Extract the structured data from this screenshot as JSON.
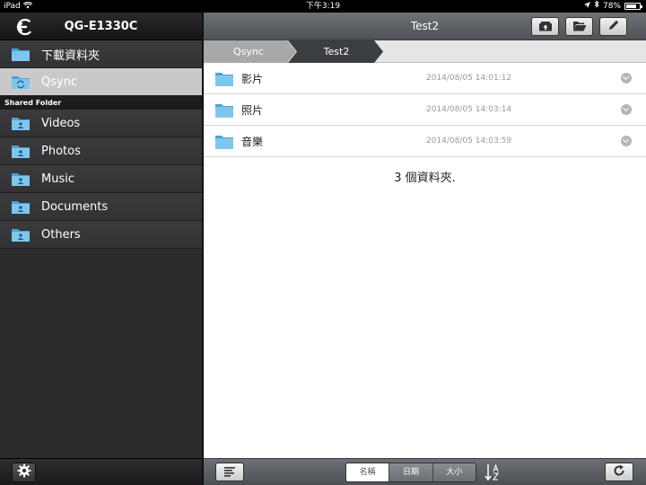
{
  "status_bar": {
    "device": "iPad",
    "time": "下午3:19",
    "battery": "78%",
    "battery_level": 0.78
  },
  "sidebar": {
    "title": "QG-E1330C",
    "items": [
      {
        "label": "下載資料夾",
        "icon": "folder-icon",
        "selected": false
      },
      {
        "label": "Qsync",
        "icon": "qsync-folder-icon",
        "selected": true
      }
    ],
    "section_label": "Shared Folder",
    "shared": [
      {
        "label": "Videos",
        "icon": "shared-folder-icon"
      },
      {
        "label": "Photos",
        "icon": "shared-folder-icon"
      },
      {
        "label": "Music",
        "icon": "shared-folder-icon"
      },
      {
        "label": "Documents",
        "icon": "shared-folder-icon"
      },
      {
        "label": "Others",
        "icon": "shared-folder-icon"
      }
    ]
  },
  "main": {
    "title": "Test2",
    "breadcrumb": [
      "Qsync",
      "Test2"
    ],
    "files": [
      {
        "name": "影片",
        "date": "2014/08/05 14:01:12"
      },
      {
        "name": "照片",
        "date": "2014/08/05 14:03:14"
      },
      {
        "name": "音樂",
        "date": "2014/08/05 14:03:59"
      }
    ],
    "summary": "3 個資料夾.",
    "sort_options": [
      "名稱",
      "日期",
      "大小"
    ],
    "sort_selected": "名稱"
  },
  "colors": {
    "folder": "#5fb3e0",
    "selected_item": "#c9c9cb"
  }
}
